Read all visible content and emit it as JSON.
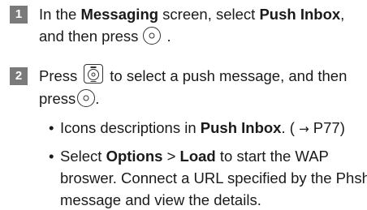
{
  "steps": [
    {
      "number": "1",
      "line1": {
        "a": "In the ",
        "b": "Messaging",
        "c": " screen, select ",
        "d": "Push Inbox",
        "e": ","
      },
      "line2": {
        "a": "and then press",
        "key": "center-key-icon",
        "b": "."
      }
    },
    {
      "number": "2",
      "line1": {
        "a": "Press",
        "key": "navigation-key-icon",
        "b": "to select a push message, and then"
      },
      "line2": {
        "a": "press",
        "key": "center-key-icon",
        "b": "."
      }
    }
  ],
  "bullets": [
    {
      "a": "Icons descriptions in ",
      "b": "Push Inbox",
      "c": ". (",
      "arrow": "→",
      "d": "P77)"
    },
    {
      "a": "Select ",
      "b": "Options",
      "c": " > ",
      "d": "Load",
      "e": " to start the WAP",
      "line2": "broswer. Connect a URL specified by the Phsh",
      "line3": "message and view the details."
    }
  ]
}
